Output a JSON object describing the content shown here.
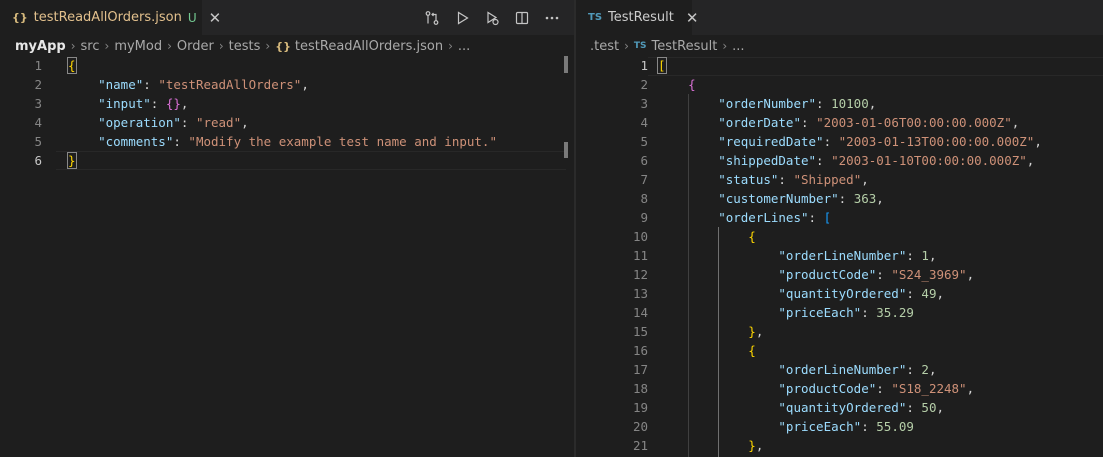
{
  "left": {
    "tab": {
      "icon": "{}",
      "label": "testReadAllOrders.json",
      "status": "U",
      "close": "✕"
    },
    "actions": [
      "compare-changes-icon",
      "run-icon",
      "debug-run-icon",
      "split-editor-icon",
      "more-icon"
    ],
    "breadcrumb": [
      {
        "label": "myApp",
        "bold": true
      },
      {
        "label": "src"
      },
      {
        "label": "myMod"
      },
      {
        "label": "Order"
      },
      {
        "label": "tests"
      },
      {
        "label": "testReadAllOrders.json",
        "icon": "{}"
      },
      {
        "label": "..."
      }
    ],
    "lines": [
      {
        "n": "1",
        "tokens": [
          [
            "bk-y",
            "{"
          ]
        ]
      },
      {
        "n": "2",
        "tokens": [
          [
            "k",
            "    \"name\""
          ],
          [
            "p",
            ": "
          ],
          [
            "s",
            "\"testReadAllOrders\""
          ],
          [
            "p",
            ","
          ]
        ]
      },
      {
        "n": "3",
        "tokens": [
          [
            "k",
            "    \"input\""
          ],
          [
            "p",
            ": "
          ],
          [
            "bk-p",
            "{}"
          ],
          [
            "p",
            ","
          ]
        ]
      },
      {
        "n": "4",
        "tokens": [
          [
            "k",
            "    \"operation\""
          ],
          [
            "p",
            ": "
          ],
          [
            "s",
            "\"read\""
          ],
          [
            "p",
            ","
          ]
        ]
      },
      {
        "n": "5",
        "tokens": [
          [
            "k",
            "    \"comments\""
          ],
          [
            "p",
            ": "
          ],
          [
            "s",
            "\"Modify the example test name and input.\""
          ]
        ]
      },
      {
        "n": "6",
        "tokens": [
          [
            "bk-y",
            "}"
          ]
        ]
      }
    ]
  },
  "right": {
    "tab": {
      "icon": "TS",
      "label": "TestResult",
      "close": "✕"
    },
    "breadcrumb": [
      {
        "label": ".test"
      },
      {
        "label": "TestResult",
        "icon": "TS"
      },
      {
        "label": "..."
      }
    ],
    "lines": [
      {
        "n": "1",
        "tokens": [
          [
            "bk-y",
            "["
          ]
        ]
      },
      {
        "n": "2",
        "tokens": [
          [
            "bk-p",
            "    {"
          ]
        ]
      },
      {
        "n": "3",
        "tokens": [
          [
            "k",
            "        \"orderNumber\""
          ],
          [
            "p",
            ": "
          ],
          [
            "n",
            "10100"
          ],
          [
            "p",
            ","
          ]
        ]
      },
      {
        "n": "4",
        "tokens": [
          [
            "k",
            "        \"orderDate\""
          ],
          [
            "p",
            ": "
          ],
          [
            "s",
            "\"2003-01-06T00:00:00.000Z\""
          ],
          [
            "p",
            ","
          ]
        ]
      },
      {
        "n": "5",
        "tokens": [
          [
            "k",
            "        \"requiredDate\""
          ],
          [
            "p",
            ": "
          ],
          [
            "s",
            "\"2003-01-13T00:00:00.000Z\""
          ],
          [
            "p",
            ","
          ]
        ]
      },
      {
        "n": "6",
        "tokens": [
          [
            "k",
            "        \"shippedDate\""
          ],
          [
            "p",
            ": "
          ],
          [
            "s",
            "\"2003-01-10T00:00:00.000Z\""
          ],
          [
            "p",
            ","
          ]
        ]
      },
      {
        "n": "7",
        "tokens": [
          [
            "k",
            "        \"status\""
          ],
          [
            "p",
            ": "
          ],
          [
            "s",
            "\"Shipped\""
          ],
          [
            "p",
            ","
          ]
        ]
      },
      {
        "n": "8",
        "tokens": [
          [
            "k",
            "        \"customerNumber\""
          ],
          [
            "p",
            ": "
          ],
          [
            "n",
            "363"
          ],
          [
            "p",
            ","
          ]
        ]
      },
      {
        "n": "9",
        "tokens": [
          [
            "k",
            "        \"orderLines\""
          ],
          [
            "p",
            ": "
          ],
          [
            "bk-b",
            "["
          ]
        ]
      },
      {
        "n": "10",
        "tokens": [
          [
            "bk-y",
            "            {"
          ]
        ]
      },
      {
        "n": "11",
        "tokens": [
          [
            "k",
            "                \"orderLineNumber\""
          ],
          [
            "p",
            ": "
          ],
          [
            "n",
            "1"
          ],
          [
            "p",
            ","
          ]
        ]
      },
      {
        "n": "12",
        "tokens": [
          [
            "k",
            "                \"productCode\""
          ],
          [
            "p",
            ": "
          ],
          [
            "s",
            "\"S24_3969\""
          ],
          [
            "p",
            ","
          ]
        ]
      },
      {
        "n": "13",
        "tokens": [
          [
            "k",
            "                \"quantityOrdered\""
          ],
          [
            "p",
            ": "
          ],
          [
            "n",
            "49"
          ],
          [
            "p",
            ","
          ]
        ]
      },
      {
        "n": "14",
        "tokens": [
          [
            "k",
            "                \"priceEach\""
          ],
          [
            "p",
            ": "
          ],
          [
            "n",
            "35.29"
          ]
        ]
      },
      {
        "n": "15",
        "tokens": [
          [
            "bk-y",
            "            }"
          ],
          [
            "p",
            ","
          ]
        ]
      },
      {
        "n": "16",
        "tokens": [
          [
            "bk-y",
            "            {"
          ]
        ]
      },
      {
        "n": "17",
        "tokens": [
          [
            "k",
            "                \"orderLineNumber\""
          ],
          [
            "p",
            ": "
          ],
          [
            "n",
            "2"
          ],
          [
            "p",
            ","
          ]
        ]
      },
      {
        "n": "18",
        "tokens": [
          [
            "k",
            "                \"productCode\""
          ],
          [
            "p",
            ": "
          ],
          [
            "s",
            "\"S18_2248\""
          ],
          [
            "p",
            ","
          ]
        ]
      },
      {
        "n": "19",
        "tokens": [
          [
            "k",
            "                \"quantityOrdered\""
          ],
          [
            "p",
            ": "
          ],
          [
            "n",
            "50"
          ],
          [
            "p",
            ","
          ]
        ]
      },
      {
        "n": "20",
        "tokens": [
          [
            "k",
            "                \"priceEach\""
          ],
          [
            "p",
            ": "
          ],
          [
            "n",
            "55.09"
          ]
        ]
      },
      {
        "n": "21",
        "tokens": [
          [
            "bk-y",
            "            }"
          ],
          [
            "p",
            ","
          ]
        ]
      }
    ]
  }
}
